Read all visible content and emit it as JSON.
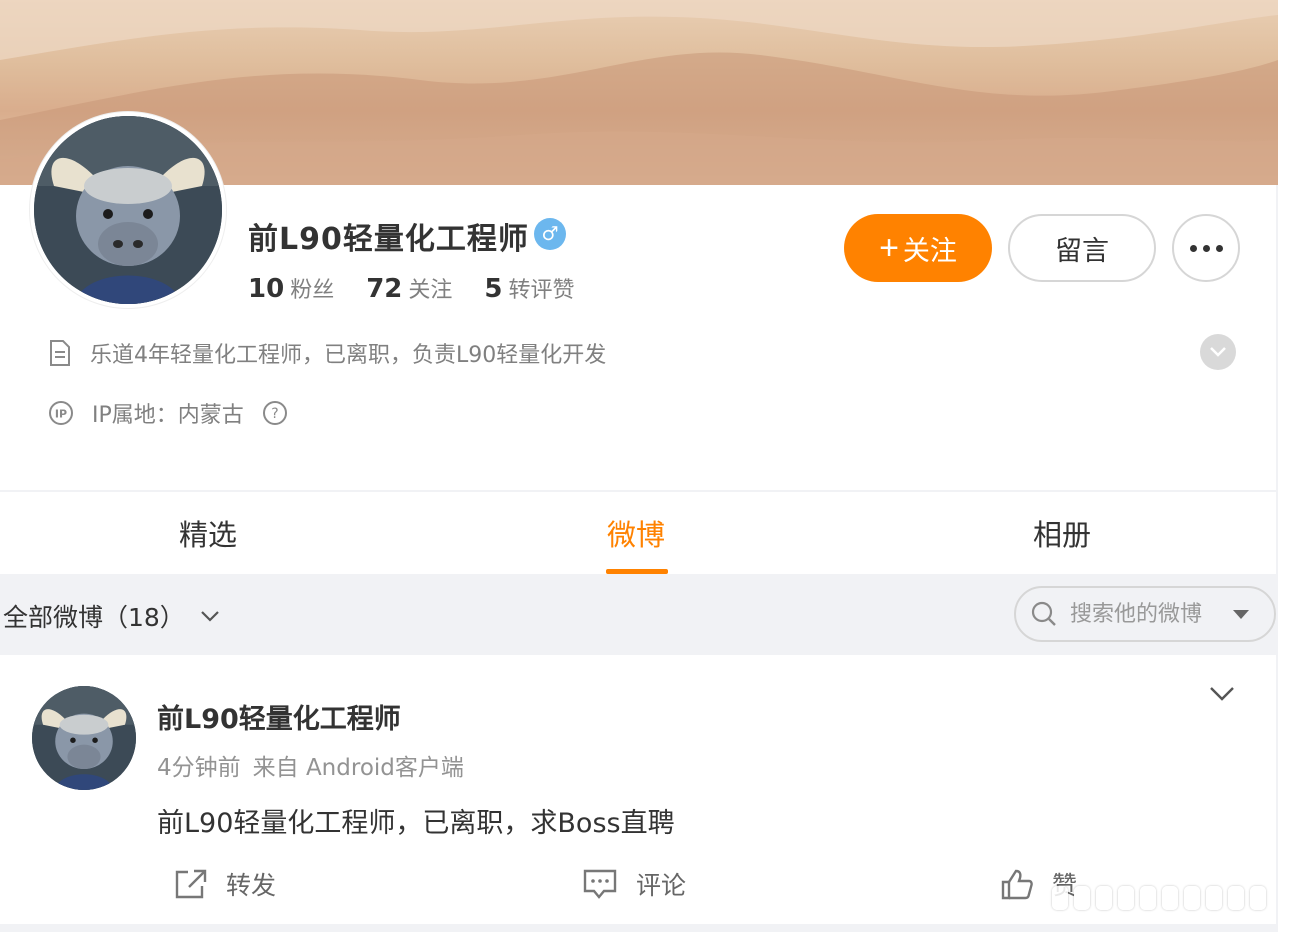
{
  "profile": {
    "name": "前L90轻量化工程师",
    "gender_icon": "♂",
    "stats": [
      {
        "num": "10",
        "label": "粉丝"
      },
      {
        "num": "72",
        "label": "关注"
      },
      {
        "num": "5",
        "label": "转评赞"
      }
    ],
    "follow_label": "关注",
    "follow_plus": "+",
    "message_label": "留言",
    "bio": "乐道4年轻量化工程师，已离职，负责L90轻量化开发",
    "ip": "IP属地：内蒙古"
  },
  "tabs": [
    {
      "label": "精选"
    },
    {
      "label": "微博"
    },
    {
      "label": "相册"
    }
  ],
  "filter": {
    "label": "全部微博（18）",
    "search_placeholder": "搜索他的微博"
  },
  "post": {
    "name": "前L90轻量化工程师",
    "time": "4分钟前",
    "source": "来自 Android客户端",
    "text": "前L90轻量化工程师，已离职，求Boss直聘",
    "actions": {
      "repost": "转发",
      "comment": "评论",
      "like": "赞"
    }
  },
  "colors": {
    "accent": "#ff8200",
    "male_badge": "#6cb7ee"
  }
}
